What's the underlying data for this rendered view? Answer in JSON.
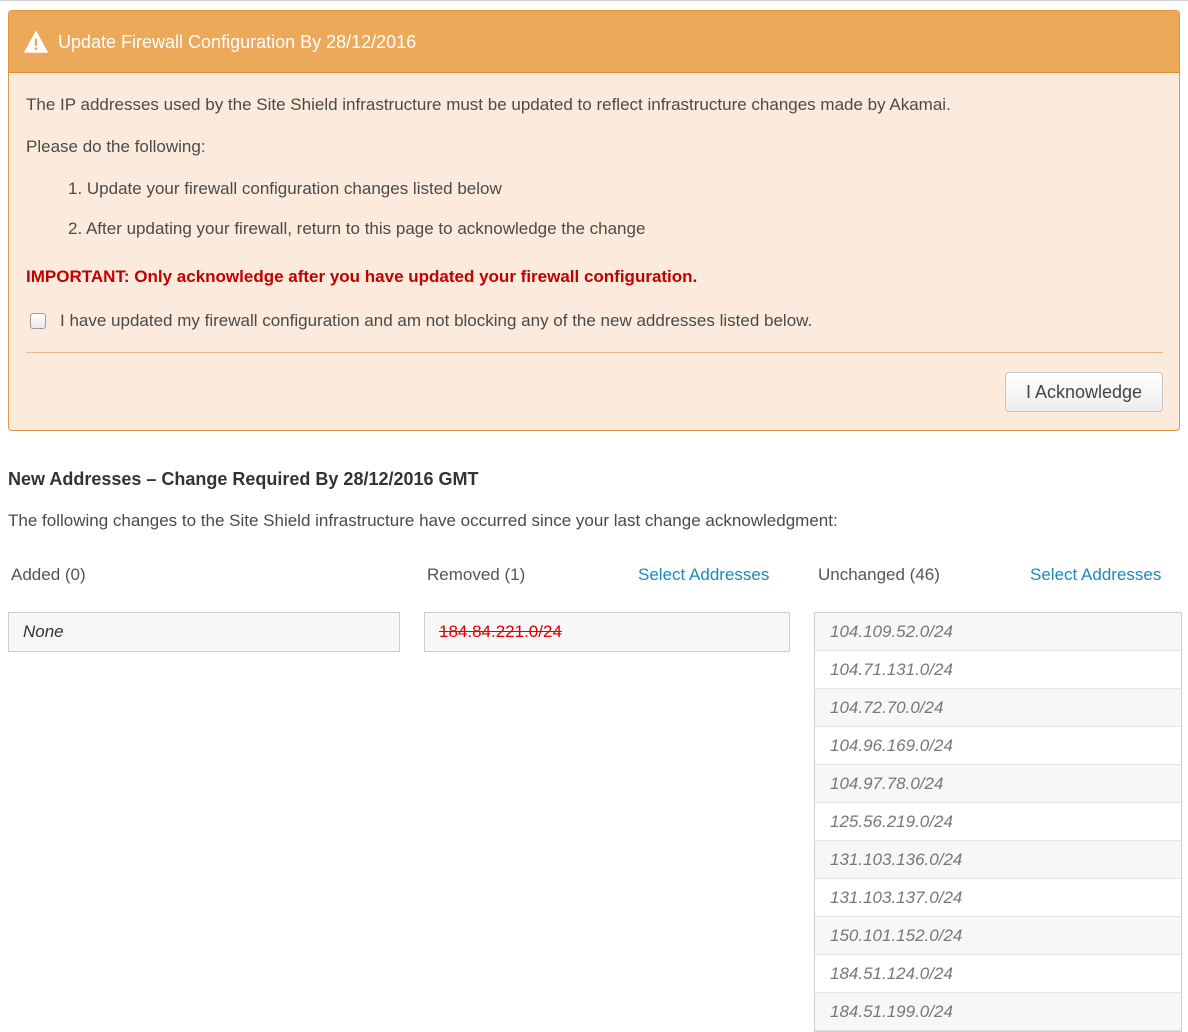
{
  "notice": {
    "title": "Update Firewall Configuration By 28/12/2016",
    "intro": "The IP addresses used by the Site Shield infrastructure must be updated to reflect infrastructure changes made by Akamai.",
    "instructions_lead": "Please do the following:",
    "steps": [
      "1. Update your firewall configuration changes listed below",
      "2. After updating your firewall, return to this page to acknowledge the change"
    ],
    "important": "IMPORTANT: Only acknowledge after you have updated your firewall configuration.",
    "checkbox_label": "I have updated my firewall configuration and am not blocking any of the new addresses listed below.",
    "checkbox_checked": false,
    "acknowledge_button": "I Acknowledge",
    "header_color": "#eca95a",
    "body_color": "#fcebdc"
  },
  "addresses": {
    "heading": "New Addresses – Change Required By 28/12/2016 GMT",
    "description": "The following changes to the Site Shield infrastructure have occurred since your last change acknowledgment:",
    "added": {
      "label": "Added (0)",
      "items": [
        "None"
      ]
    },
    "removed": {
      "label": "Removed (1)",
      "select_link": "Select Addresses",
      "items": [
        "184.84.221.0/24"
      ]
    },
    "unchanged": {
      "label": "Unchanged (46)",
      "select_link": "Select Addresses",
      "items": [
        "104.109.52.0/24",
        "104.71.131.0/24",
        "104.72.70.0/24",
        "104.96.169.0/24",
        "104.97.78.0/24",
        "125.56.219.0/24",
        "131.103.136.0/24",
        "131.103.137.0/24",
        "150.101.152.0/24",
        "184.51.124.0/24",
        "184.51.199.0/24"
      ]
    },
    "link_color": "#1a8abf",
    "removed_color": "#e00000"
  }
}
